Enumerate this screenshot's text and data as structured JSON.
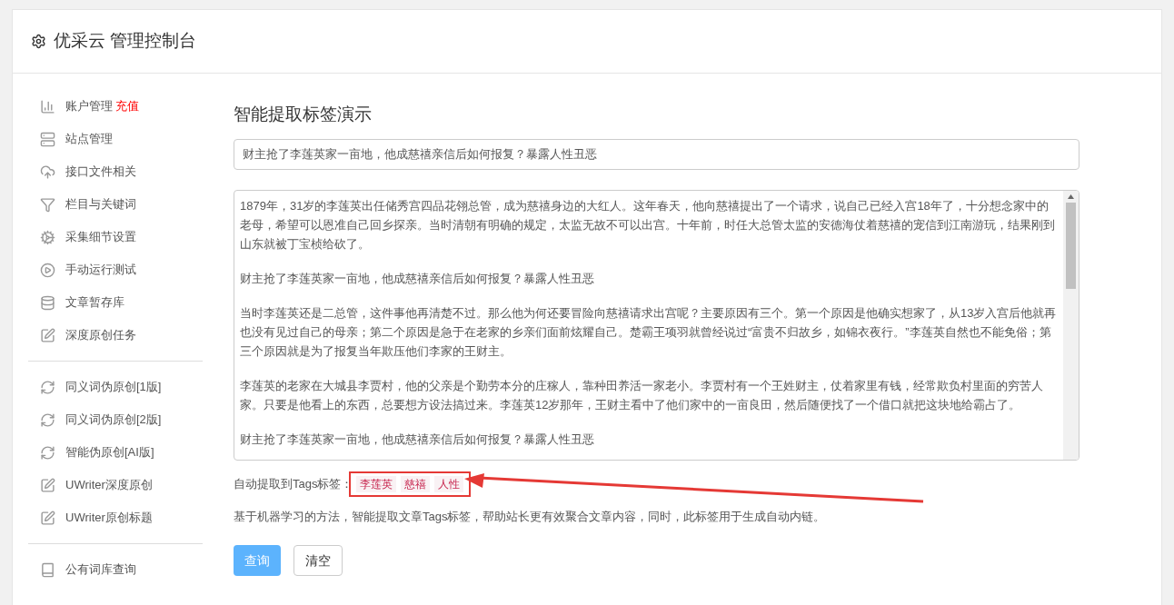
{
  "header": {
    "title": "优采云 管理控制台"
  },
  "sidebar": {
    "groups": [
      [
        {
          "label": "账户管理",
          "badge": "充值"
        },
        {
          "label": "站点管理"
        },
        {
          "label": "接口文件相关"
        },
        {
          "label": "栏目与关键词"
        },
        {
          "label": "采集细节设置"
        },
        {
          "label": "手动运行测试"
        },
        {
          "label": "文章暂存库"
        },
        {
          "label": "深度原创任务"
        }
      ],
      [
        {
          "label": "同义词伪原创[1版]"
        },
        {
          "label": "同义词伪原创[2版]"
        },
        {
          "label": "智能伪原创[AI版]"
        },
        {
          "label": "UWriter深度原创"
        },
        {
          "label": "UWriter原创标题"
        }
      ],
      [
        {
          "label": "公有词库查询"
        }
      ]
    ]
  },
  "main": {
    "heading": "智能提取标签演示",
    "title_value": "财主抢了李莲英家一亩地，他成慈禧亲信后如何报复？暴露人性丑恶",
    "content_paragraphs": [
      "1879年，31岁的李莲英出任储秀宫四品花翎总管，成为慈禧身边的大红人。这年春天，他向慈禧提出了一个请求，说自己已经入宫18年了，十分想念家中的老母，希望可以恩准自己回乡探亲。当时清朝有明确的规定，太监无故不可以出宫。十年前，时任大总管太监的安德海仗着慈禧的宠信到江南游玩，结果刚到山东就被丁宝桢给砍了。",
      "财主抢了李莲英家一亩地，他成慈禧亲信后如何报复？暴露人性丑恶",
      "当时李莲英还是二总管，这件事他再清楚不过。那么他为何还要冒险向慈禧请求出宫呢？主要原因有三个。第一个原因是他确实想家了，从13岁入宫后他就再也没有见过自己的母亲；第二个原因是急于在老家的乡亲们面前炫耀自己。楚霸王项羽就曾经说过“富贵不归故乡，如锦衣夜行。”李莲英自然也不能免俗；第三个原因就是为了报复当年欺压他们李家的王财主。",
      "李莲英的老家在大城县李贾村，他的父亲是个勤劳本分的庄稼人，靠种田养活一家老小。李贾村有一个王姓财主，仗着家里有钱，经常欺负村里面的穷苦人家。只要是他看上的东西，总要想方设法搞过来。李莲英12岁那年，王财主看中了他们家中的一亩良田，然后随便找了一个借口就把这块地给霸占了。",
      "财主抢了李莲英家一亩地，他成慈禧亲信后如何报复？暴露人性丑恶"
    ],
    "tags_label": "自动提取到Tags标签：",
    "tags": [
      "李莲英",
      "慈禧",
      "人性"
    ],
    "description": "基于机器学习的方法，智能提取文章Tags标签，帮助站长更有效聚合文章内容，同时，此标签用于生成自动内链。",
    "buttons": [
      {
        "label": "查询",
        "kind": "primary"
      },
      {
        "label": "清空",
        "kind": "default"
      }
    ]
  }
}
